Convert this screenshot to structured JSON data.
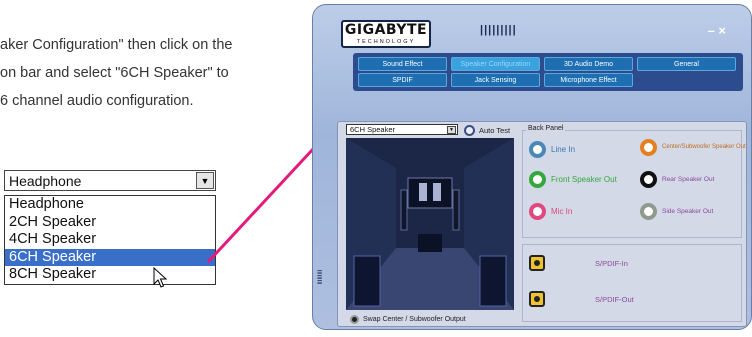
{
  "instructions": {
    "line1": "aker Configuration\" then click on the",
    "line2": "on bar and select \"6CH Speaker\" to",
    "line3": "6 channel audio configuration."
  },
  "dropdown": {
    "selected": "Headphone",
    "options": [
      "Headphone",
      "2CH Speaker",
      "4CH Speaker",
      "6CH Speaker",
      "8CH Speaker"
    ],
    "highlighted": "6CH Speaker"
  },
  "app": {
    "logo": "GIGABYTE",
    "logo_sub": "TECHNOLOGY",
    "grip": "|||||||||",
    "window_controls": "– ×",
    "tabs": {
      "sound_effect": "Sound Effect",
      "speaker_configuration": "Speaker Configuration",
      "audio_demo": "3D Audio Demo",
      "general": "General",
      "spdif": "SPDIF",
      "jack_sensing": "Jack Sensing",
      "mic_effect": "Microphone Effect"
    },
    "speaker_select": "6CH Speaker",
    "auto_test": "Auto Test",
    "swap": "Swap Center / Subwoofer Output",
    "back_panel": {
      "title": "Back Panel",
      "line_in": "Line In",
      "front_out": "Front Speaker Out",
      "mic_in": "Mic In",
      "center_sub": "Center/Subwoofer Speaker Out",
      "rear_out": "Rear Speaker Out",
      "side_out": "Side Speaker Out"
    },
    "spdif_in": "S/PDIF-In",
    "spdif_out": "S/PDIF-Out",
    "colors": {
      "accent_arrow": "#e51a7a",
      "highlight": "#3a6fc9",
      "line_in": "#4a88b8",
      "front_out": "#34a83c",
      "mic_in": "#e0487e",
      "center_sub": "#e38020",
      "rear_out": "#111111",
      "side_out": "#8e9a8e"
    }
  }
}
